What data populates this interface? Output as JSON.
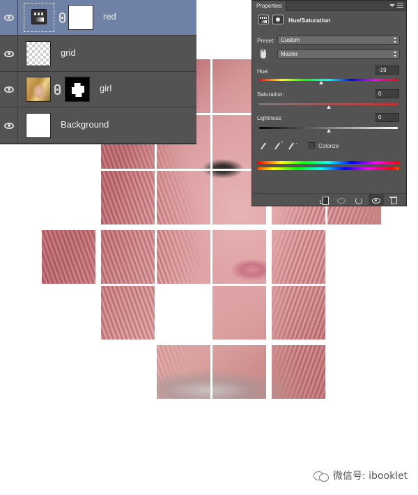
{
  "layers": [
    {
      "name": "red",
      "selected": true,
      "thumb": "adjustment-hue-saturation",
      "linked": true,
      "mask": "white"
    },
    {
      "name": "grid",
      "selected": false,
      "thumb": "transparent",
      "linked": false,
      "mask": null
    },
    {
      "name": "girl",
      "selected": false,
      "thumb": "photo",
      "linked": true,
      "mask": "black-with-white-shape"
    },
    {
      "name": "Background",
      "selected": false,
      "thumb": "white",
      "linked": false,
      "mask": null
    }
  ],
  "properties": {
    "tab": "Properties",
    "panel_title": "Hue/Saturation",
    "preset_label": "Preset:",
    "preset_value": "Custom",
    "channel_value": "Master",
    "hue_label": "Hue:",
    "hue_value": "-19",
    "saturation_label": "Saturation:",
    "saturation_value": "0",
    "lightness_label": "Lightness:",
    "lightness_value": "0",
    "colorize_label": "Colorize",
    "hue_level": -19,
    "saturation_level": 0,
    "lightness_level": 0
  },
  "watermark": {
    "text": "微信号: ibooklet"
  },
  "colors": {
    "panel_bg": "#535353",
    "selected_row": "#6f81a5",
    "canvas_bg": "#ffffff"
  },
  "icons": [
    "eye-icon",
    "link-icon",
    "hand-icon",
    "eyedropper-icon",
    "clip-icon",
    "view-previous-icon",
    "reset-icon",
    "visibility-icon",
    "trash-icon",
    "panel-menu-icon"
  ]
}
